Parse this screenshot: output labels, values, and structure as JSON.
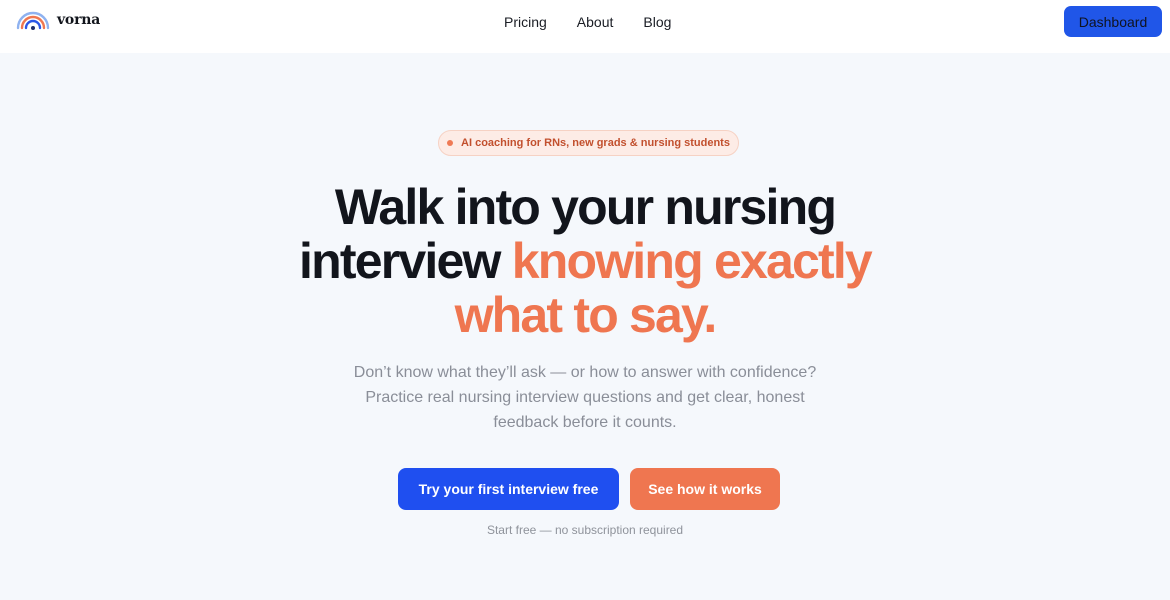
{
  "brand": {
    "name": "vorna",
    "colors": {
      "primary_blue": "#1f4ff0",
      "accent_orange": "#ef7650",
      "background": "#f5f8fc"
    },
    "logo_icon": "rainbow-arc-icon"
  },
  "nav": {
    "items": [
      {
        "label": "Pricing"
      },
      {
        "label": "About"
      },
      {
        "label": "Blog"
      }
    ],
    "dashboard_label": "Dashboard"
  },
  "hero": {
    "badge": "AI coaching for RNs, new grads & nursing students",
    "headline_dark_1": "Walk into your nursing",
    "headline_dark_2": "interview",
    "headline_accent_1": "knowing exactly",
    "headline_accent_2": "what to say.",
    "subtext_line_1": "Don’t know what they’ll ask — or how to answer with confidence?",
    "subtext_line_2": "Practice real nursing interview questions and get clear, honest",
    "subtext_line_3": "feedback before it counts.",
    "primary_cta": "Try your first interview free",
    "secondary_cta": "See how it works",
    "footnote": "Start free — no subscription required"
  }
}
